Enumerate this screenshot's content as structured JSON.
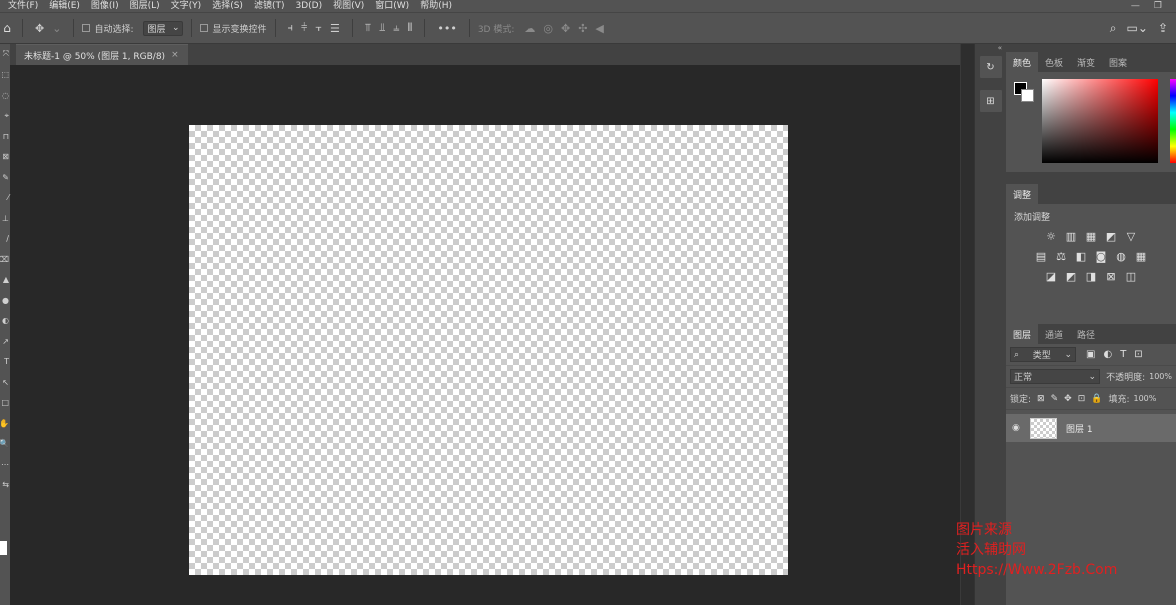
{
  "menu": [
    "文件(F)",
    "编辑(E)",
    "图像(I)",
    "图层(L)",
    "文字(Y)",
    "选择(S)",
    "滤镜(T)",
    "3D(D)",
    "视图(V)",
    "窗口(W)",
    "帮助(H)"
  ],
  "window_controls": {
    "minimize": "—",
    "restore": "❐"
  },
  "options_bar": {
    "auto_select_label": "自动选择:",
    "target_select": "图层",
    "show_transform_label": "显示变换控件",
    "mode_3d_label": "3D 模式:",
    "more": "•••"
  },
  "tools": [
    "⤧",
    "⬚",
    "◌",
    "⌖",
    "⊓",
    "⊠",
    "✎",
    "⁄",
    "⊥",
    "∕",
    "⌫",
    "▲",
    "●",
    "◐",
    "↗",
    "T",
    "↖",
    "□",
    "✋",
    "🔍",
    "⋯",
    "⇆"
  ],
  "document": {
    "tab_title": "未标题-1 @ 50% (图层 1, RGB/8)",
    "close": "×"
  },
  "color_panel": {
    "tabs": [
      "颜色",
      "色板",
      "渐变",
      "图案"
    ],
    "active_tab": 0
  },
  "adjustments_panel": {
    "tab": "调整",
    "title": "添加调整",
    "rows": [
      [
        "☼",
        "▥",
        "▦",
        "◩",
        "▽"
      ],
      [
        "▤",
        "⚖",
        "◧",
        "◙",
        "◍",
        "▦"
      ],
      [
        "◪",
        "◩",
        "◨",
        "⊠",
        "◫"
      ]
    ]
  },
  "layers_panel": {
    "tabs": [
      "图层",
      "通道",
      "路径"
    ],
    "active_tab": 0,
    "filter_label": "类型",
    "filter_icons": [
      "▣",
      "◐",
      "T",
      "⊡"
    ],
    "blend_mode": "正常",
    "opacity_label": "不透明度:",
    "opacity_value": "100%",
    "lock_label": "锁定:",
    "lock_icons": [
      "⊠",
      "✎",
      "✥",
      "⊡",
      "🔒"
    ],
    "fill_label": "填充:",
    "fill_value": "100%",
    "layers": [
      {
        "name": "图层 1",
        "visible_icon": "◉"
      }
    ]
  },
  "watermark": [
    "图片来源",
    "活入辅助网",
    "Https://Www.2Fzb.Com"
  ],
  "colors": {
    "ui_panel": "#535353",
    "ui_dark": "#424242",
    "workspace": "#282828",
    "watermark": "#e02020"
  }
}
